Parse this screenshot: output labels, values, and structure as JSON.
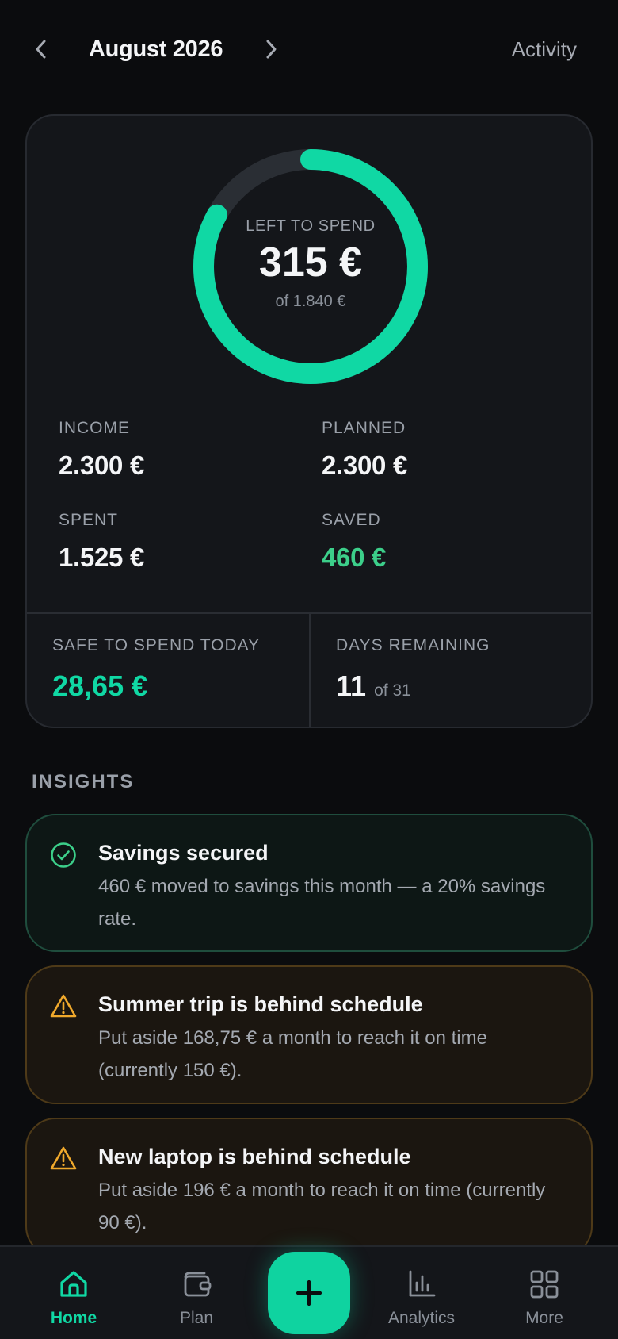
{
  "header": {
    "month_title": "August 2026",
    "activity_label": "Activity",
    "prev_icon": "chevron-left-icon",
    "next_icon": "chevron-right-icon"
  },
  "budget_ring": {
    "label": "LEFT TO SPEND",
    "amount": "315 €",
    "total": "of 1.840 €",
    "fraction_left": 0.17,
    "color_progress": "#10d8a4",
    "color_track": "#2a2e34"
  },
  "stats": {
    "income_label": "INCOME",
    "income_value": "2.300 €",
    "planned_label": "PLANNED",
    "planned_value": "2.300 €",
    "spent_label": "SPENT",
    "spent_value": "1.525 €",
    "saved_label": "SAVED",
    "saved_value": "460 €"
  },
  "footer": {
    "safe_label": "SAFE TO SPEND TODAY",
    "safe_value": "28,65 €",
    "days_label": "DAYS REMAINING",
    "days_value": "11",
    "days_of": "of 31"
  },
  "insights": {
    "heading": "INSIGHTS",
    "items": [
      {
        "kind": "success",
        "icon": "check-circle-icon",
        "title": "Savings secured",
        "body": "460 € moved to savings this month — a 20% savings rate."
      },
      {
        "kind": "warning",
        "icon": "warning-triangle-icon",
        "title": "Summer trip is behind schedule",
        "body": "Put aside 168,75 € a month to reach it on time (currently 150 €)."
      },
      {
        "kind": "warning",
        "icon": "warning-triangle-icon",
        "title": "New laptop is behind schedule",
        "body": "Put aside 196 € a month to reach it on time (currently 90 €)."
      }
    ]
  },
  "tabbar": {
    "active": "Home",
    "accent": "#10d8a4",
    "tabs": [
      {
        "label": "Home",
        "icon": "home-icon"
      },
      {
        "label": "Plan",
        "icon": "wallet-icon"
      },
      {
        "label": "Analytics",
        "icon": "bar-chart-icon"
      },
      {
        "label": "More",
        "icon": "grid-icon"
      }
    ],
    "fab_icon": "plus-icon"
  }
}
